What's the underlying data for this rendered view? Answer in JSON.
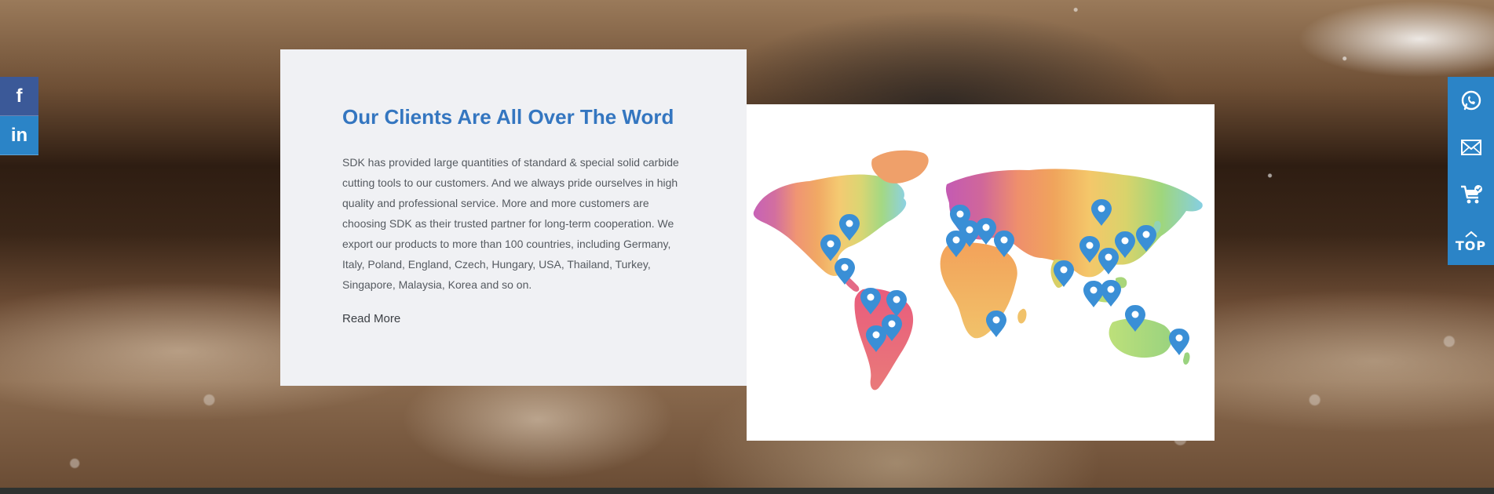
{
  "social": {
    "facebook_icon": "facebook-icon",
    "linkedin_icon": "linkedin-icon",
    "facebook_glyph": "f",
    "linkedin_glyph": "in"
  },
  "clients_section": {
    "title": "Our Clients Are All Over The Word",
    "body": "SDK has provided large quantities of standard & special solid carbide cutting tools to our customers. And we always pride ourselves in high quality and professional service. More and more customers are choosing SDK as their trusted partner for long-term cooperation. We export our products to more than 100 countries, including Germany, Italy, Poland, England, Czech, Hungary, USA, Thailand, Turkey, Singapore, Malaysia, Korea and so on.",
    "read_more_label": "Read More"
  },
  "map": {
    "image_name": "world-map-with-client-markers",
    "marker_color": "#3a8fd6"
  },
  "utility_rail": {
    "whatsapp_icon": "whatsapp-icon",
    "email_icon": "email-icon",
    "cart_icon": "cart-icon",
    "top_label": "TOP"
  },
  "colors": {
    "accent_blue": "#3476c0",
    "rail_blue": "#2b84c7",
    "facebook_blue": "#3b5998",
    "card_background": "#f0f1f4"
  }
}
